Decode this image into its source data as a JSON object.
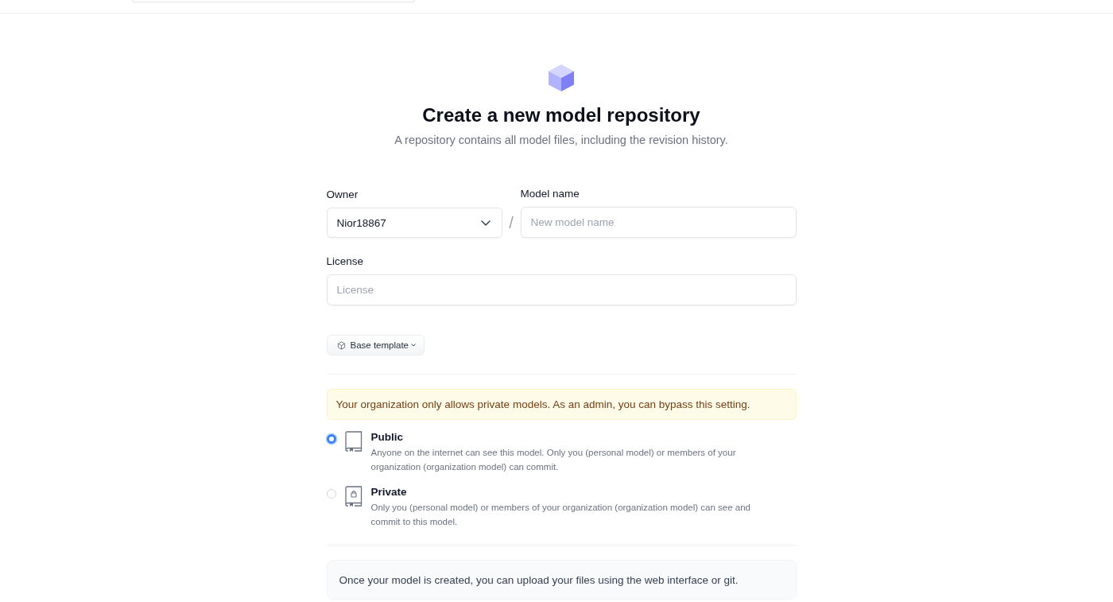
{
  "hero": {
    "title": "Create a new model repository",
    "subtitle": "A repository contains all model files, including the revision history."
  },
  "form": {
    "owner": {
      "label": "Owner",
      "value": "Nior18867"
    },
    "separator": "/",
    "model_name": {
      "label": "Model name",
      "placeholder": "New model name"
    },
    "license": {
      "label": "License",
      "placeholder": "License"
    },
    "base_template": {
      "label": "Base template"
    },
    "notice": "Your organization only allows private models. As an admin, you can bypass this setting.",
    "visibility": [
      {
        "kind": "public",
        "title": "Public",
        "description": "Anyone on the internet can see this model. Only you (personal model) or members of your organization (organization model) can commit.",
        "selected": true
      },
      {
        "kind": "private",
        "title": "Private",
        "description": "Only you (personal model) or members of your organization (organization model) can see and commit to this model.",
        "selected": false
      }
    ],
    "info": "Once your model is created, you can upload your files using the web interface or git."
  }
}
